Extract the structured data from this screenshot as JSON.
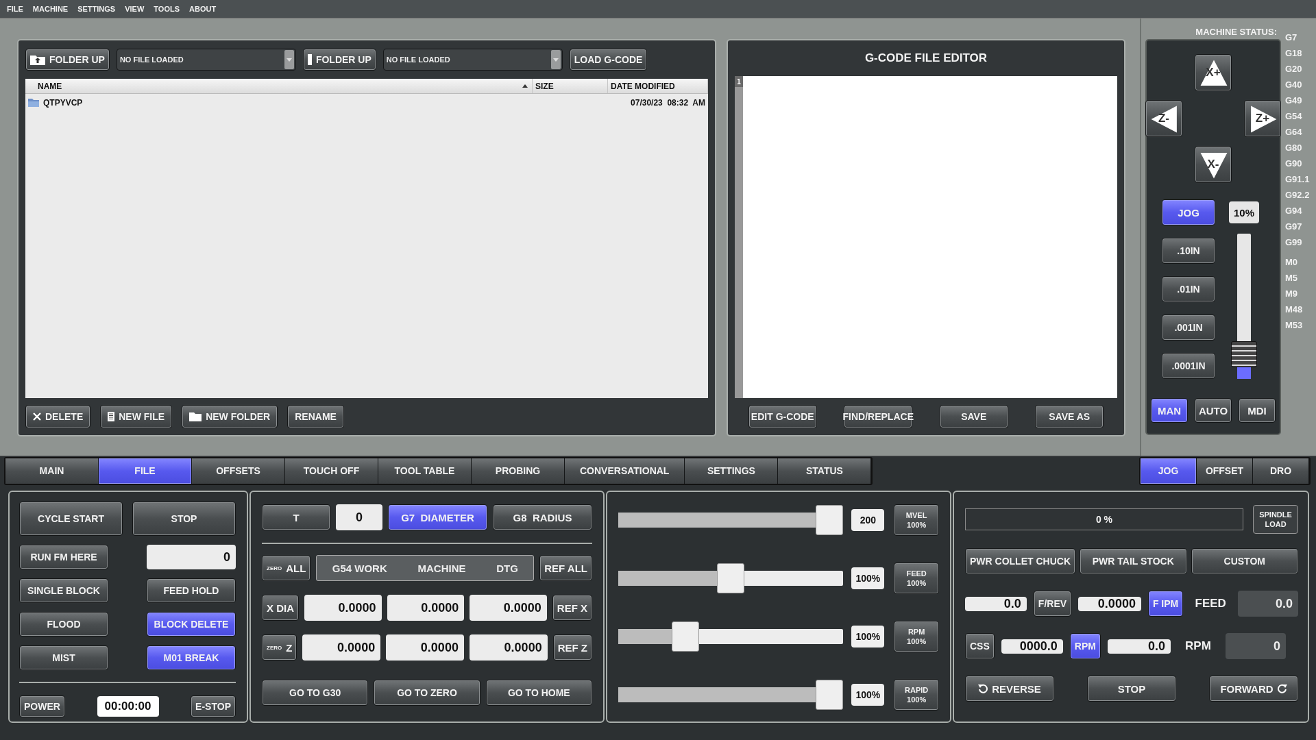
{
  "menu": [
    "FILE",
    "MACHINE",
    "SETTINGS",
    "VIEW",
    "TOOLS",
    "ABOUT"
  ],
  "file_browser": {
    "toolbar": [
      {
        "kind": "button",
        "label": "FOLDER UP"
      },
      {
        "kind": "dropdown",
        "value": "NO FILE LOADED"
      },
      {
        "kind": "button",
        "label": "FOLDER UP"
      },
      {
        "kind": "dropdown",
        "value": "NO FILE LOADED"
      },
      {
        "kind": "button",
        "label": "LOAD G-CODE"
      }
    ],
    "columns": [
      {
        "label": "NAME",
        "sorted": true
      },
      {
        "label": "SIZE",
        "sorted": false
      },
      {
        "label": "DATE MODIFIED",
        "sorted": false
      }
    ],
    "rows": [
      {
        "name": "QTPYVCP",
        "date_modified": "07/30/23  08:32  AM"
      }
    ],
    "actions": [
      "DELETE",
      "NEW FILE",
      "NEW FOLDER",
      "RENAME"
    ]
  },
  "editor": {
    "title": "G-CODE FILE EDITOR",
    "line_numbers": [
      "1"
    ],
    "buttons": [
      "EDIT G-CODE",
      "FIND/REPLACE",
      "SAVE",
      "SAVE AS"
    ]
  },
  "machine_status": {
    "label": "MACHINE STATUS:",
    "g_codes": [
      "G7",
      "G18",
      "G20",
      "G40",
      "G49",
      "G54",
      "G64",
      "G80",
      "G90",
      "G91.1",
      "G92.2",
      "G94",
      "G97",
      "G99"
    ],
    "m_codes": [
      "M0",
      "M5",
      "M9",
      "M48",
      "M53"
    ]
  },
  "jog": {
    "arrows": [
      "X+",
      "Z-",
      "Z+",
      "X-"
    ],
    "jog_button": {
      "label": "JOG",
      "selected": true
    },
    "rate": "10%",
    "rate_slider": {
      "level": 0.1
    },
    "increments": [
      {
        "label": ".10IN",
        "selected": false
      },
      {
        "label": ".01IN",
        "selected": false
      },
      {
        "label": ".001IN",
        "selected": false
      },
      {
        "label": ".0001IN",
        "selected": false
      }
    ],
    "modes": [
      {
        "label": "MAN",
        "selected": true
      },
      {
        "label": "AUTO",
        "selected": false
      },
      {
        "label": "MDI",
        "selected": false
      }
    ]
  },
  "tabs": [
    {
      "label": "MAIN",
      "selected": false
    },
    {
      "label": "FILE",
      "selected": true
    },
    {
      "label": "OFFSETS",
      "selected": false
    },
    {
      "label": "TOUCH OFF",
      "selected": false
    },
    {
      "label": "TOOL TABLE",
      "selected": false
    },
    {
      "label": "PROBING",
      "selected": false
    },
    {
      "label": "CONVERSATIONAL",
      "selected": false
    },
    {
      "label": "SETTINGS",
      "selected": false
    },
    {
      "label": "STATUS",
      "selected": false
    }
  ],
  "side_tabs": [
    {
      "label": "JOG",
      "selected": true
    },
    {
      "label": "OFFSET",
      "selected": false
    },
    {
      "label": "DRO",
      "selected": false
    }
  ],
  "run_panel": {
    "cycle_start": "CYCLE START",
    "stop": "STOP",
    "run_from_here": "RUN FM HERE",
    "start_line": "0",
    "toggles": [
      {
        "label": "SINGLE BLOCK",
        "on": false
      },
      {
        "label": "FEED HOLD",
        "on": false
      },
      {
        "label": "FLOOD",
        "on": false
      },
      {
        "label": "BLOCK DELETE",
        "on": true
      },
      {
        "label": "MIST",
        "on": false
      },
      {
        "label": "M01 BREAK",
        "on": true
      }
    ],
    "power": "POWER",
    "timer": "00:00:00",
    "estop": "E-STOP"
  },
  "dro_panel": {
    "tool_button": "T",
    "tool": "0",
    "modes": [
      {
        "label": "G7  DIAMETER",
        "selected": true
      },
      {
        "label": "G8  RADIUS",
        "selected": false
      }
    ],
    "zero_all": {
      "small": "ZERO",
      "label": "ALL"
    },
    "headers": [
      "G54 WORK",
      "MACHINE",
      "DTG"
    ],
    "ref_all": "REF ALL",
    "axes": [
      {
        "zero": {
          "label": "X DIA"
        },
        "values": [
          "0.0000",
          "0.0000",
          "0.0000"
        ],
        "ref": "REF X"
      },
      {
        "zero": {
          "small": "ZERO",
          "label": "Z"
        },
        "values": [
          "0.0000",
          "0.0000",
          "0.0000"
        ],
        "ref": "REF Z"
      }
    ],
    "goto": [
      "GO TO G30",
      "GO TO ZERO",
      "GO TO HOME"
    ]
  },
  "overrides": [
    {
      "level": 1,
      "value": "200",
      "label": "MVEL",
      "percent": "100%"
    },
    {
      "level": 0.5,
      "value": "100%",
      "label": "FEED",
      "percent": "100%"
    },
    {
      "level": 0.27,
      "value": "100%",
      "label": "RPM",
      "percent": "100%"
    },
    {
      "level": 1,
      "value": "100%",
      "label": "RAPID",
      "percent": "100%"
    }
  ],
  "spindle": {
    "load": {
      "level": 0,
      "text": "0 %"
    },
    "load_button": "SPINDLE LOAD",
    "accessories": [
      "PWR COLLET CHUCK",
      "PWR TAIL STOCK",
      "CUSTOM"
    ],
    "feed_row": {
      "input": "0.0",
      "mode_a": {
        "label": "F/REV",
        "selected": false
      },
      "input2": "0.0000",
      "mode_b": {
        "label": "F IPM",
        "selected": true
      },
      "label": "FEED",
      "readout": "0.0"
    },
    "speed_row": {
      "mode_a": {
        "label": "CSS",
        "selected": false
      },
      "input": "0000.0",
      "mode_b": {
        "label": "RPM",
        "selected": true
      },
      "input2": "0.0",
      "label": "RPM",
      "readout": "0"
    },
    "direction": [
      "REVERSE",
      "STOP",
      "FORWARD"
    ]
  }
}
